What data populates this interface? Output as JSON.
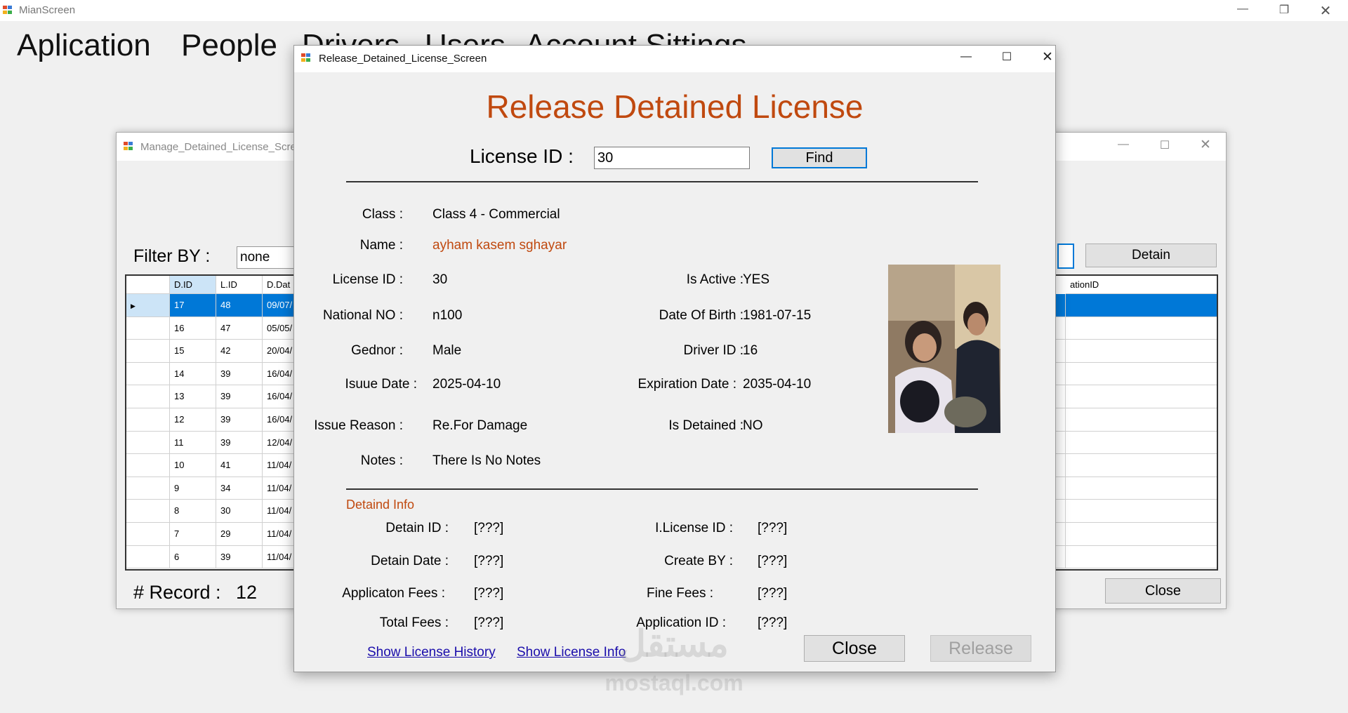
{
  "main_window": {
    "title": "MianScreen",
    "menu": [
      "Aplication",
      "People",
      "Drivers",
      "Users",
      "Account Sittings"
    ]
  },
  "manage_window": {
    "title": "Manage_Detained_License_Screen",
    "filter_label": "Filter BY :",
    "filter_value": "none",
    "detain_button": "Detain",
    "close_button": "Close",
    "record_label": "# Record :",
    "record_count": "12",
    "columns": [
      "D.ID",
      "L.ID",
      "D.Dat",
      "ationID"
    ],
    "rows": [
      {
        "did": "17",
        "lid": "48",
        "date": "09/07/"
      },
      {
        "did": "16",
        "lid": "47",
        "date": "05/05/"
      },
      {
        "did": "15",
        "lid": "42",
        "date": "20/04/"
      },
      {
        "did": "14",
        "lid": "39",
        "date": "16/04/"
      },
      {
        "did": "13",
        "lid": "39",
        "date": "16/04/"
      },
      {
        "did": "12",
        "lid": "39",
        "date": "16/04/"
      },
      {
        "did": "11",
        "lid": "39",
        "date": "12/04/"
      },
      {
        "did": "10",
        "lid": "41",
        "date": "11/04/"
      },
      {
        "did": "9",
        "lid": "34",
        "date": "11/04/"
      },
      {
        "did": "8",
        "lid": "30",
        "date": "11/04/"
      },
      {
        "did": "7",
        "lid": "29",
        "date": "11/04/"
      },
      {
        "did": "6",
        "lid": "39",
        "date": "11/04/"
      }
    ]
  },
  "release_window": {
    "title": "Release_Detained_License_Screen",
    "heading": "Release Detained License",
    "license_id_label": "License ID :",
    "license_id_value": "30",
    "find_button": "Find",
    "info": {
      "class_label": "Class :",
      "class_value": "Class 4 - Commercial",
      "name_label": "Name :",
      "name_value": "ayham kasem sghayar",
      "license_id_label": "License ID :",
      "license_id_value": "30",
      "is_active_label": "Is Active :",
      "is_active_value": "YES",
      "national_no_label": "National NO :",
      "national_no_value": "n100",
      "dob_label": "Date Of Birth :",
      "dob_value": "1981-07-15",
      "gender_label": "Gednor :",
      "gender_value": "Male",
      "driver_id_label": "Driver ID :",
      "driver_id_value": "16",
      "issue_date_label": "Isuue Date :",
      "issue_date_value": "2025-04-10",
      "expiration_label": "Expiration Date :",
      "expiration_value": "2035-04-10",
      "issue_reason_label": "Issue Reason :",
      "issue_reason_value": "Re.For Damage",
      "is_detained_label": "Is Detained :",
      "is_detained_value": "NO",
      "notes_label": "Notes :",
      "notes_value": "There Is No Notes"
    },
    "detain_section": "Detaind Info",
    "detain": {
      "detain_id_label": "Detain ID  :",
      "detain_id_value": "[???]",
      "ilicense_label": "I.License ID  :",
      "ilicense_value": "[???]",
      "detain_date_label": "Detain Date :",
      "detain_date_value": "[???]",
      "create_by_label": "Create BY :",
      "create_by_value": "[???]",
      "app_fees_label": "Applicaton Fees :",
      "app_fees_value": "[???]",
      "fine_fees_label": "Fine Fees :",
      "fine_fees_value": "[???]",
      "total_fees_label": "Total Fees :",
      "total_fees_value": "[???]",
      "app_id_label": "Application ID :",
      "app_id_value": "[???]"
    },
    "link_history": "Show License History",
    "link_info": "Show License Info",
    "close_button": "Close",
    "release_button": "Release"
  },
  "watermark": {
    "arabic": "مستقل",
    "latin": "mostaql.com"
  },
  "colors": {
    "heading": "#c0490f",
    "link": "#1a0dab",
    "selection": "#0078d7"
  }
}
